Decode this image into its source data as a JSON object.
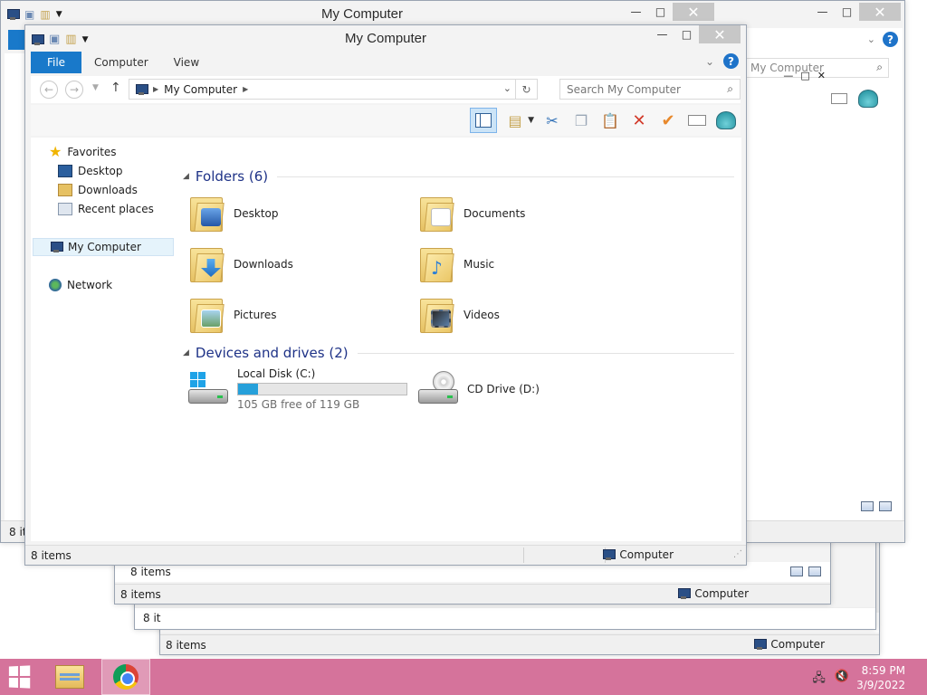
{
  "window_title": "My Computer",
  "ribbon": {
    "tab_file": "File",
    "tab_computer": "Computer",
    "tab_view": "View",
    "help": "?"
  },
  "address": {
    "path": "My Computer",
    "search_placeholder": "Search My Computer"
  },
  "nav_pane": {
    "favorites": "Favorites",
    "desktop": "Desktop",
    "downloads": "Downloads",
    "recent_places": "Recent places",
    "my_computer": "My Computer",
    "network": "Network"
  },
  "folders_group": {
    "title": "Folders (6)",
    "items": [
      "Desktop",
      "Documents",
      "Downloads",
      "Music",
      "Pictures",
      "Videos"
    ]
  },
  "drives_group": {
    "title": "Devices and drives (2)",
    "local_disk": {
      "name": "Local Disk (C:)",
      "free_text": "105 GB free of 119 GB",
      "used_fraction": 0.118
    },
    "cd_drive": {
      "name": "CD Drive (D:)"
    }
  },
  "status": {
    "items_count": "8 items",
    "location": "Computer"
  },
  "background_windows": {
    "title": "My Computer",
    "items_count": "8 items",
    "location": "Computer",
    "truncated_items": "8 it",
    "search_placeholder_partial": "My Computer"
  },
  "taskbar": {
    "time": "8:59 PM",
    "date": "3/9/2022"
  },
  "colors": {
    "accent": "#1979ca",
    "taskbar": "#d5739b",
    "progress": "#26a0da"
  }
}
